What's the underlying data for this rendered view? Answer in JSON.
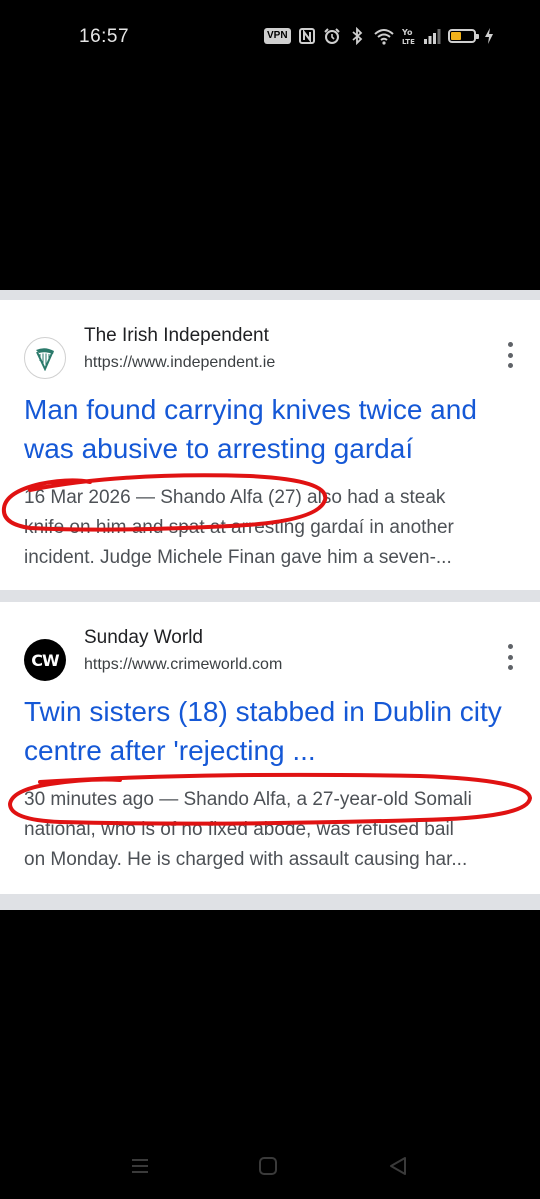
{
  "status_bar": {
    "time": "16:57",
    "vpn_label": "VPN",
    "icons": [
      "nfc-icon",
      "alarm-icon",
      "bluetooth-icon",
      "wifi-icon",
      "volte-icon",
      "signal-icon",
      "battery-icon",
      "charging-icon"
    ]
  },
  "results": [
    {
      "source": "The Irish Independent",
      "url": "https://www.independent.ie",
      "favicon": "harp-icon",
      "title": "Man found carrying knives twice and was abusive to arresting gardaí",
      "snippet_lines": [
        "16 Mar 2026 — Shando Alfa (27) also had a steak",
        "knife on him and spat at arresting gardaí in another",
        "incident. Judge Michele Finan gave him a seven-..."
      ]
    },
    {
      "source": "Sunday World",
      "url": "https://www.crimeworld.com",
      "favicon": "cw-logo-icon",
      "favicon_text": "CW",
      "title": "Twin sisters (18) stabbed in Dublin city centre after 'rejecting ...",
      "snippet_lines": [
        "30 minutes ago — Shando Alfa, a 27-year-old Somali",
        "national, who is of no fixed abode, was refused bail",
        "on Monday. He is charged with assault causing har..."
      ]
    }
  ],
  "colors": {
    "title_link": "#1558d6",
    "annotation": "#e01212",
    "background": "#000000"
  },
  "nav": [
    "recent-apps-icon",
    "home-icon",
    "back-icon"
  ]
}
